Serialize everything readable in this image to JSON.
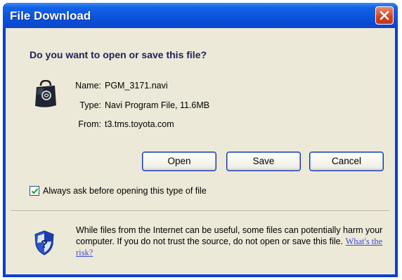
{
  "window": {
    "title": "File Download",
    "close_label": "Close"
  },
  "dialog": {
    "question": "Do you want to open or save this file?",
    "file": {
      "name_label": "Name:",
      "name_value": "PGM_3171.navi",
      "type_label": "Type:",
      "type_value": "Navi Program File, 11.6MB",
      "from_label": "From:",
      "from_value": "t3.tms.toyota.com",
      "icon": "file-type-icon"
    },
    "buttons": {
      "open": "Open",
      "save": "Save",
      "cancel": "Cancel"
    },
    "always_ask": {
      "label": "Always ask before opening this type of file",
      "checked": true
    },
    "warning": {
      "text": "While files from the Internet can be useful, some files can potentially harm your computer. If you do not trust the source, do not open or save this file.",
      "link": "What's the risk?",
      "icon": "security-shield-icon"
    }
  },
  "colors": {
    "titlebar": "#0a52dc",
    "dialog_bg": "#ece9d8",
    "close_button": "#d3401e",
    "link": "#3b4bd6"
  }
}
